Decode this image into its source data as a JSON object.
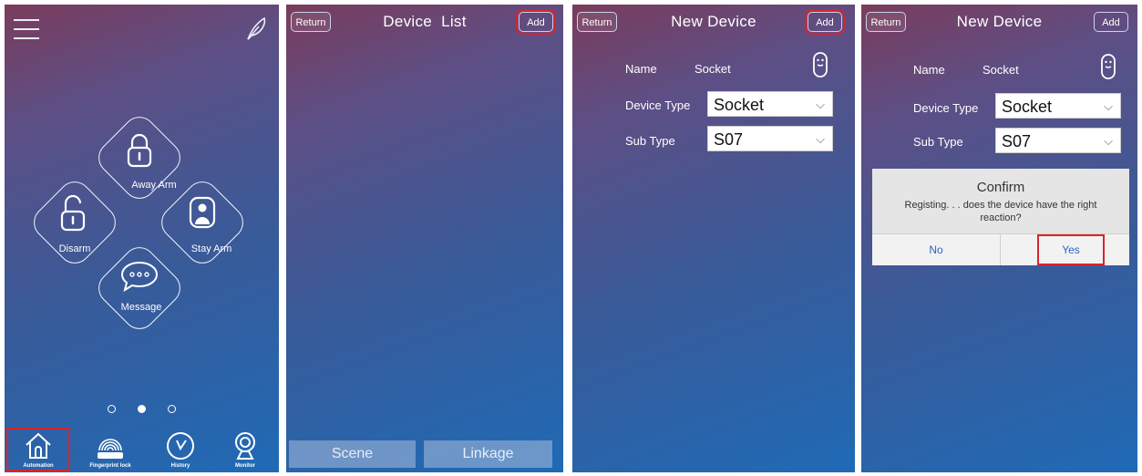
{
  "screen1": {
    "arm_buttons": {
      "away": "Away Arm",
      "disarm": "Disarm",
      "stay": "Stay Arm",
      "message": "Message"
    },
    "page_dots": {
      "count": 3,
      "active": 2
    },
    "nav": [
      "Automation",
      "Fingerprint lock",
      "History",
      "Monitor"
    ]
  },
  "screen2": {
    "return_label": "Return",
    "title": "Device  List",
    "add_label": "Add",
    "tabs": [
      "Scene",
      "Linkage"
    ]
  },
  "screen3": {
    "return_label": "Return",
    "title": "New Device",
    "add_label": "Add",
    "name_label": "Name",
    "name_value": "Socket",
    "device_type_label": "Device Type",
    "device_type_value": "Socket",
    "sub_type_label": "Sub Type",
    "sub_type_value": "S07"
  },
  "screen4": {
    "return_label": "Return",
    "title": "New Device",
    "add_label": "Add",
    "name_label": "Name",
    "name_value": "Socket",
    "device_type_label": "Device Type",
    "device_type_value": "Socket",
    "sub_type_label": "Sub Type",
    "sub_type_value": "S07",
    "dialog": {
      "title": "Confirm",
      "message": "Registing. . . does the device have the right reaction?",
      "no": "No",
      "yes": "Yes"
    }
  },
  "colors": {
    "highlight": "#d9242b",
    "dialog_button_text": "#2b63c8"
  }
}
